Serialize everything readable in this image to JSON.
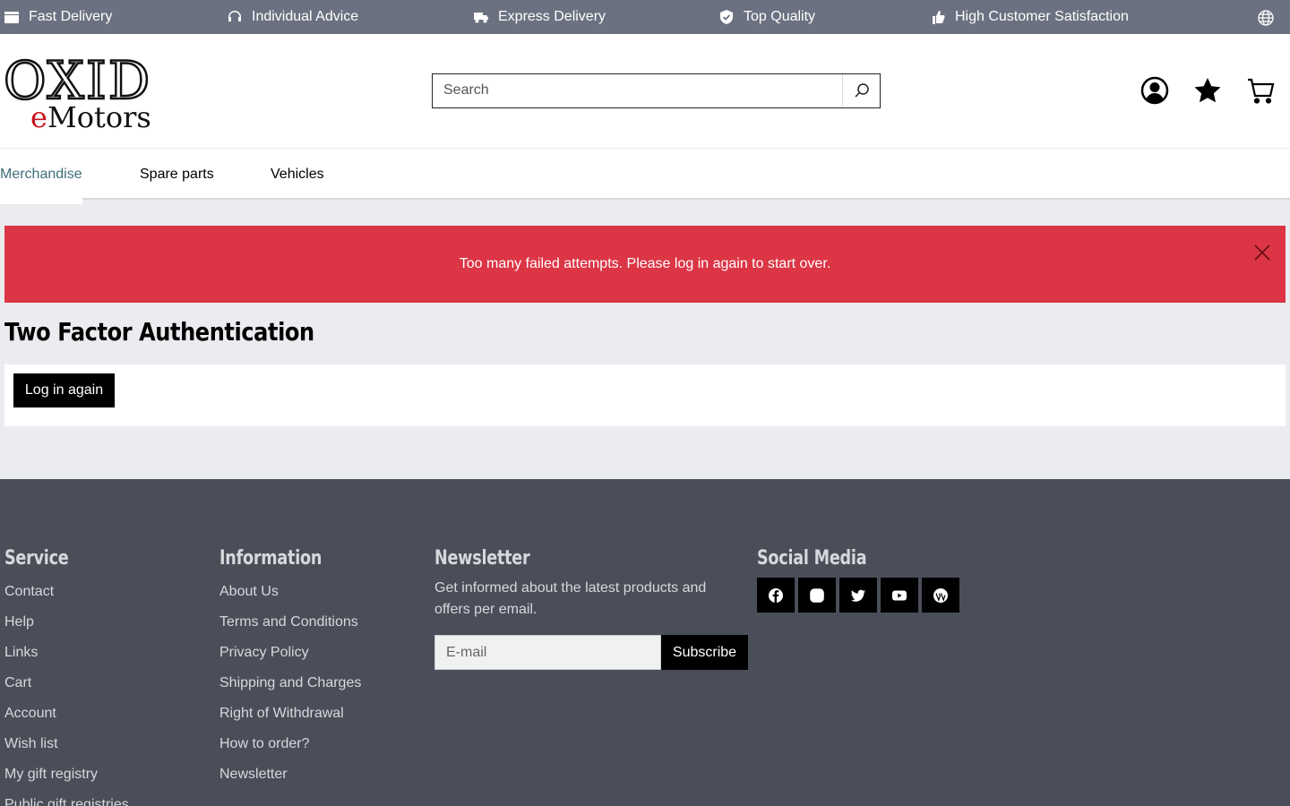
{
  "topbar": {
    "items": [
      {
        "label": "Fast Delivery",
        "icon": "box-icon"
      },
      {
        "label": "Individual Advice",
        "icon": "headset-icon"
      },
      {
        "label": "Express Delivery",
        "icon": "truck-icon"
      },
      {
        "label": "Top Quality",
        "icon": "shield-check-icon"
      },
      {
        "label": "High Customer Satisfaction",
        "icon": "thumbs-up-icon"
      }
    ],
    "language_icon": "globe-icon"
  },
  "header": {
    "logo_top": "OXID",
    "logo_bottom_e": "e",
    "logo_bottom_rest": "Motors",
    "search_placeholder": "Search"
  },
  "nav": {
    "items": [
      "Merchandise",
      "Spare parts",
      "Vehicles"
    ],
    "active": "Merchandise"
  },
  "alert": {
    "message": "Too many failed attempts. Please log in again to start over."
  },
  "main": {
    "title": "Two Factor Authentication",
    "login_button": "Log in again"
  },
  "footer": {
    "service": {
      "title": "Service",
      "links": [
        "Contact",
        "Help",
        "Links",
        "Cart",
        "Account",
        "Wish list",
        "My gift registry",
        "Public gift registries"
      ]
    },
    "information": {
      "title": "Information",
      "links": [
        "About Us",
        "Terms and Conditions",
        "Privacy Policy",
        "Shipping and Charges",
        "Right of Withdrawal",
        "How to order?",
        "Newsletter"
      ]
    },
    "newsletter": {
      "title": "Newsletter",
      "text": "Get informed about the latest products and offers per email.",
      "placeholder": "E-mail",
      "button": "Subscribe"
    },
    "social": {
      "title": "Social Media",
      "icons": [
        "facebook-icon",
        "instagram-icon",
        "twitter-icon",
        "youtube-icon",
        "wordpress-icon"
      ]
    }
  },
  "colors": {
    "topbar": "#6b7180",
    "alert": "#dc3545",
    "footer": "#4a4e59",
    "nav_active": "#3f6e7a"
  }
}
